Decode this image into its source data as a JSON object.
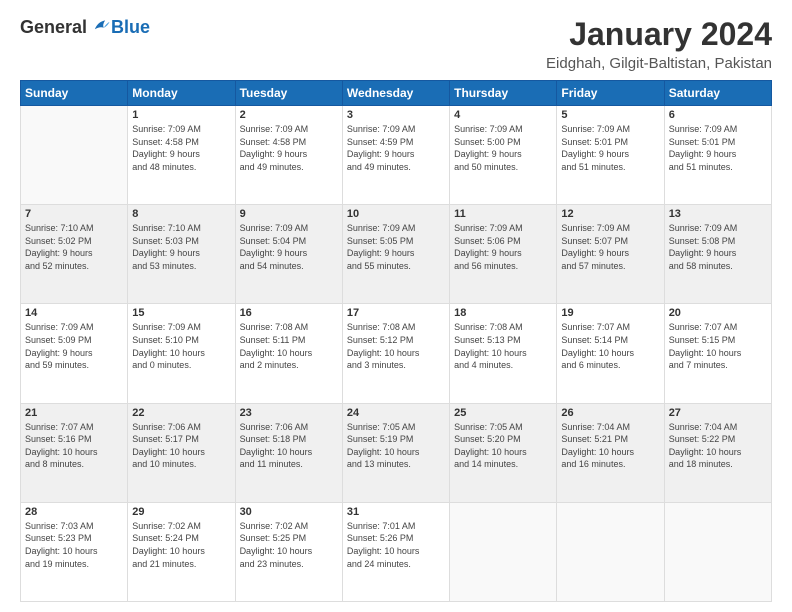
{
  "logo": {
    "general": "General",
    "blue": "Blue"
  },
  "title": "January 2024",
  "subtitle": "Eidghah, Gilgit-Baltistan, Pakistan",
  "calendar": {
    "headers": [
      "Sunday",
      "Monday",
      "Tuesday",
      "Wednesday",
      "Thursday",
      "Friday",
      "Saturday"
    ],
    "rows": [
      {
        "shaded": false,
        "cells": [
          {
            "day": "",
            "info": ""
          },
          {
            "day": "1",
            "info": "Sunrise: 7:09 AM\nSunset: 4:58 PM\nDaylight: 9 hours\nand 48 minutes."
          },
          {
            "day": "2",
            "info": "Sunrise: 7:09 AM\nSunset: 4:58 PM\nDaylight: 9 hours\nand 49 minutes."
          },
          {
            "day": "3",
            "info": "Sunrise: 7:09 AM\nSunset: 4:59 PM\nDaylight: 9 hours\nand 49 minutes."
          },
          {
            "day": "4",
            "info": "Sunrise: 7:09 AM\nSunset: 5:00 PM\nDaylight: 9 hours\nand 50 minutes."
          },
          {
            "day": "5",
            "info": "Sunrise: 7:09 AM\nSunset: 5:01 PM\nDaylight: 9 hours\nand 51 minutes."
          },
          {
            "day": "6",
            "info": "Sunrise: 7:09 AM\nSunset: 5:01 PM\nDaylight: 9 hours\nand 51 minutes."
          }
        ]
      },
      {
        "shaded": true,
        "cells": [
          {
            "day": "7",
            "info": "Sunrise: 7:10 AM\nSunset: 5:02 PM\nDaylight: 9 hours\nand 52 minutes."
          },
          {
            "day": "8",
            "info": "Sunrise: 7:10 AM\nSunset: 5:03 PM\nDaylight: 9 hours\nand 53 minutes."
          },
          {
            "day": "9",
            "info": "Sunrise: 7:09 AM\nSunset: 5:04 PM\nDaylight: 9 hours\nand 54 minutes."
          },
          {
            "day": "10",
            "info": "Sunrise: 7:09 AM\nSunset: 5:05 PM\nDaylight: 9 hours\nand 55 minutes."
          },
          {
            "day": "11",
            "info": "Sunrise: 7:09 AM\nSunset: 5:06 PM\nDaylight: 9 hours\nand 56 minutes."
          },
          {
            "day": "12",
            "info": "Sunrise: 7:09 AM\nSunset: 5:07 PM\nDaylight: 9 hours\nand 57 minutes."
          },
          {
            "day": "13",
            "info": "Sunrise: 7:09 AM\nSunset: 5:08 PM\nDaylight: 9 hours\nand 58 minutes."
          }
        ]
      },
      {
        "shaded": false,
        "cells": [
          {
            "day": "14",
            "info": "Sunrise: 7:09 AM\nSunset: 5:09 PM\nDaylight: 9 hours\nand 59 minutes."
          },
          {
            "day": "15",
            "info": "Sunrise: 7:09 AM\nSunset: 5:10 PM\nDaylight: 10 hours\nand 0 minutes."
          },
          {
            "day": "16",
            "info": "Sunrise: 7:08 AM\nSunset: 5:11 PM\nDaylight: 10 hours\nand 2 minutes."
          },
          {
            "day": "17",
            "info": "Sunrise: 7:08 AM\nSunset: 5:12 PM\nDaylight: 10 hours\nand 3 minutes."
          },
          {
            "day": "18",
            "info": "Sunrise: 7:08 AM\nSunset: 5:13 PM\nDaylight: 10 hours\nand 4 minutes."
          },
          {
            "day": "19",
            "info": "Sunrise: 7:07 AM\nSunset: 5:14 PM\nDaylight: 10 hours\nand 6 minutes."
          },
          {
            "day": "20",
            "info": "Sunrise: 7:07 AM\nSunset: 5:15 PM\nDaylight: 10 hours\nand 7 minutes."
          }
        ]
      },
      {
        "shaded": true,
        "cells": [
          {
            "day": "21",
            "info": "Sunrise: 7:07 AM\nSunset: 5:16 PM\nDaylight: 10 hours\nand 8 minutes."
          },
          {
            "day": "22",
            "info": "Sunrise: 7:06 AM\nSunset: 5:17 PM\nDaylight: 10 hours\nand 10 minutes."
          },
          {
            "day": "23",
            "info": "Sunrise: 7:06 AM\nSunset: 5:18 PM\nDaylight: 10 hours\nand 11 minutes."
          },
          {
            "day": "24",
            "info": "Sunrise: 7:05 AM\nSunset: 5:19 PM\nDaylight: 10 hours\nand 13 minutes."
          },
          {
            "day": "25",
            "info": "Sunrise: 7:05 AM\nSunset: 5:20 PM\nDaylight: 10 hours\nand 14 minutes."
          },
          {
            "day": "26",
            "info": "Sunrise: 7:04 AM\nSunset: 5:21 PM\nDaylight: 10 hours\nand 16 minutes."
          },
          {
            "day": "27",
            "info": "Sunrise: 7:04 AM\nSunset: 5:22 PM\nDaylight: 10 hours\nand 18 minutes."
          }
        ]
      },
      {
        "shaded": false,
        "cells": [
          {
            "day": "28",
            "info": "Sunrise: 7:03 AM\nSunset: 5:23 PM\nDaylight: 10 hours\nand 19 minutes."
          },
          {
            "day": "29",
            "info": "Sunrise: 7:02 AM\nSunset: 5:24 PM\nDaylight: 10 hours\nand 21 minutes."
          },
          {
            "day": "30",
            "info": "Sunrise: 7:02 AM\nSunset: 5:25 PM\nDaylight: 10 hours\nand 23 minutes."
          },
          {
            "day": "31",
            "info": "Sunrise: 7:01 AM\nSunset: 5:26 PM\nDaylight: 10 hours\nand 24 minutes."
          },
          {
            "day": "",
            "info": ""
          },
          {
            "day": "",
            "info": ""
          },
          {
            "day": "",
            "info": ""
          }
        ]
      }
    ]
  }
}
